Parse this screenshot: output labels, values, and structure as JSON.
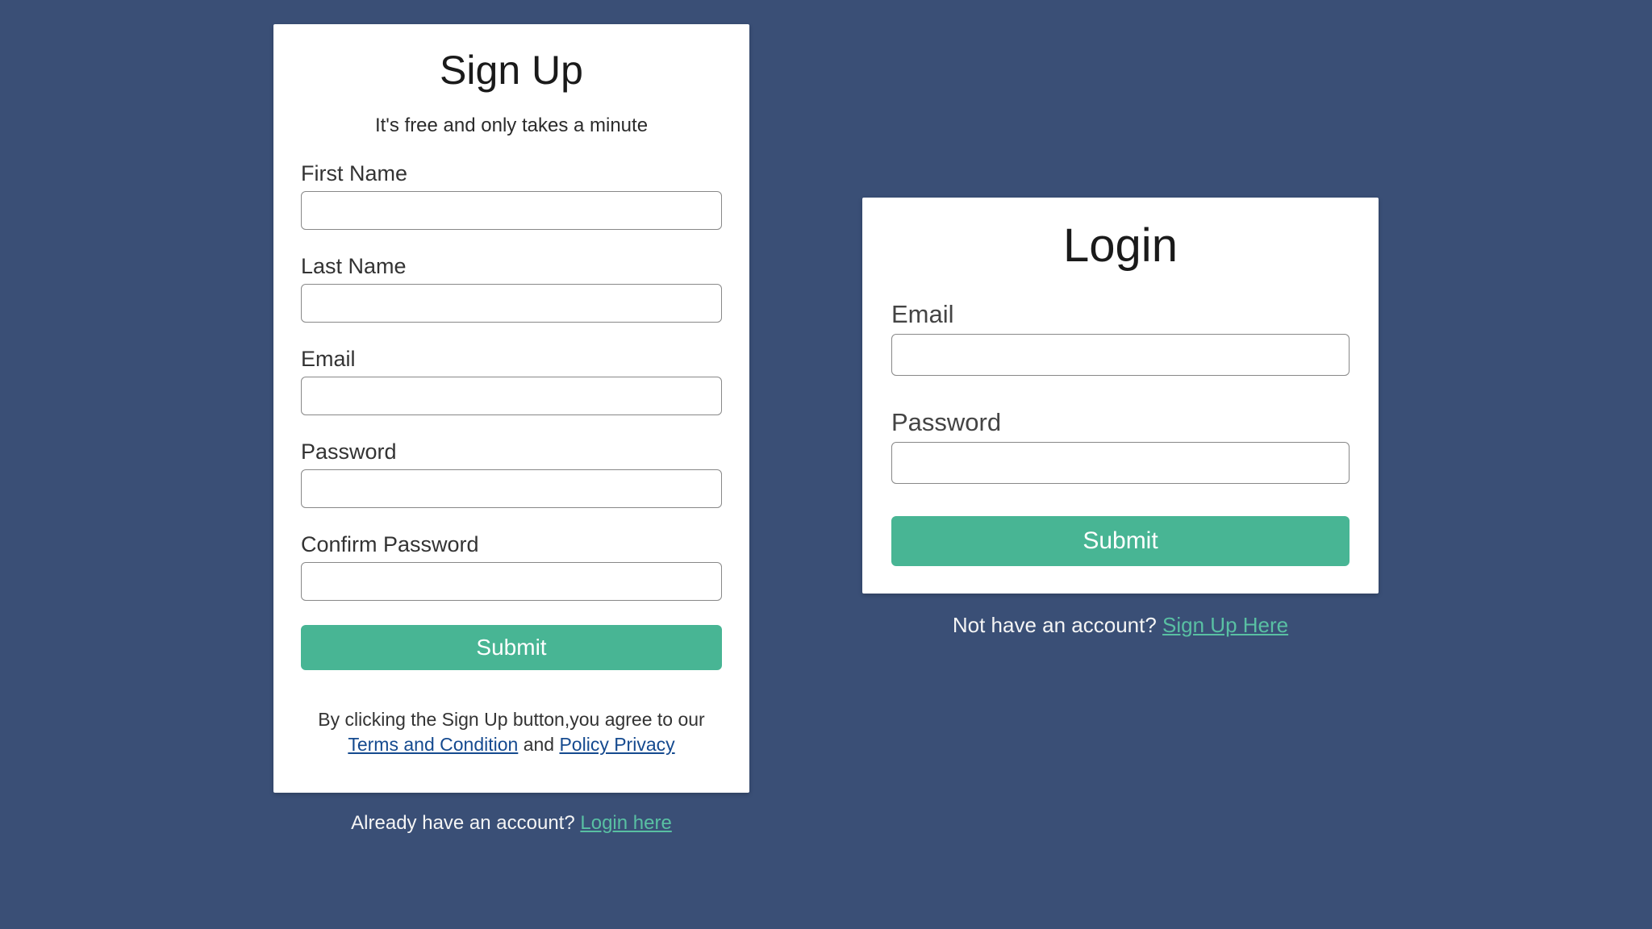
{
  "signup": {
    "title": "Sign Up",
    "subtitle": "It's free and only takes a minute",
    "fields": {
      "first_name": {
        "label": "First Name",
        "value": ""
      },
      "last_name": {
        "label": "Last Name",
        "value": ""
      },
      "email": {
        "label": "Email",
        "value": ""
      },
      "password": {
        "label": "Password",
        "value": ""
      },
      "confirm_password": {
        "label": "Confirm Password",
        "value": ""
      }
    },
    "submit_label": "Submit",
    "terms": {
      "pre": "By clicking the Sign Up button,you agree to our ",
      "terms_link": "Terms and Condition",
      "mid": " and ",
      "privacy_link": "Policy Privacy"
    },
    "below": {
      "text": "Already have an account? ",
      "link": "Login here"
    }
  },
  "login": {
    "title": "Login",
    "fields": {
      "email": {
        "label": "Email",
        "value": ""
      },
      "password": {
        "label": "Password",
        "value": ""
      }
    },
    "submit_label": "Submit",
    "below": {
      "text": "Not have an account? ",
      "link": "Sign Up Here"
    }
  }
}
